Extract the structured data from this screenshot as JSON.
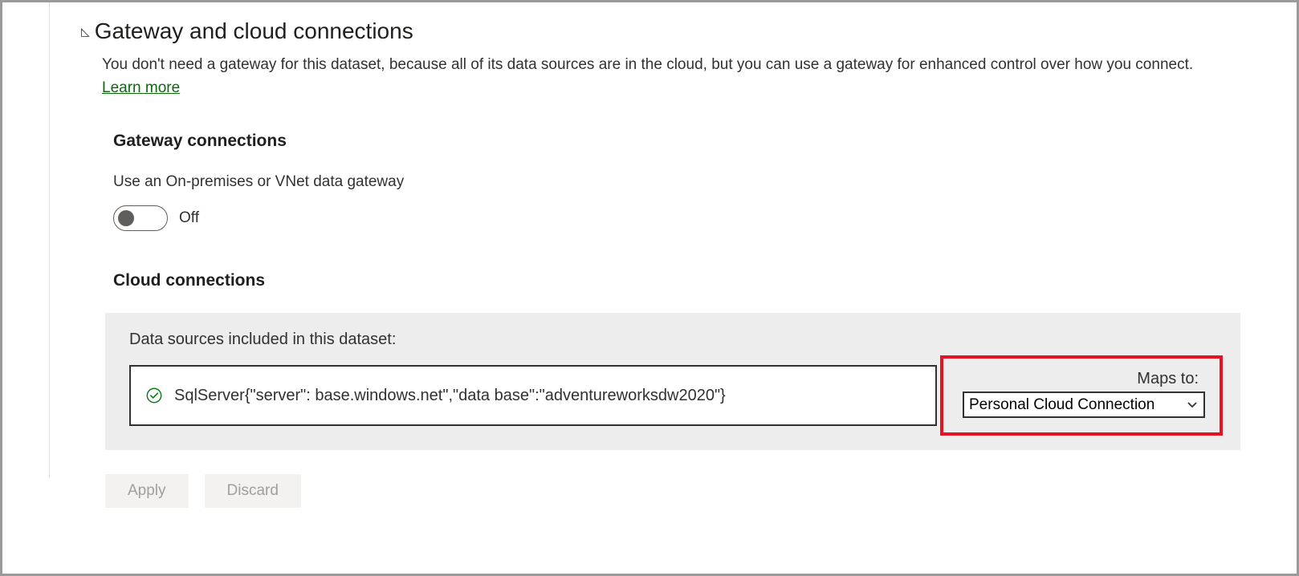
{
  "section": {
    "title": "Gateway and cloud connections",
    "description_before": "You don't need a gateway for this dataset, because all of its data sources are in the cloud, but you can use a gateway for enhanced control over how you connect. ",
    "learn_more": "Learn more"
  },
  "gateway": {
    "heading": "Gateway connections",
    "label": "Use an On-premises or VNet data gateway",
    "state": "Off"
  },
  "cloud": {
    "heading": "Cloud connections",
    "box_label": "Data sources included in this dataset:",
    "datasource_text": "SqlServer{\"server\":                       base.windows.net\",\"data base\":\"adventureworksdw2020\"}",
    "maps_to_label": "Maps to:",
    "maps_to_value": "Personal Cloud Connection"
  },
  "buttons": {
    "apply": "Apply",
    "discard": "Discard"
  }
}
